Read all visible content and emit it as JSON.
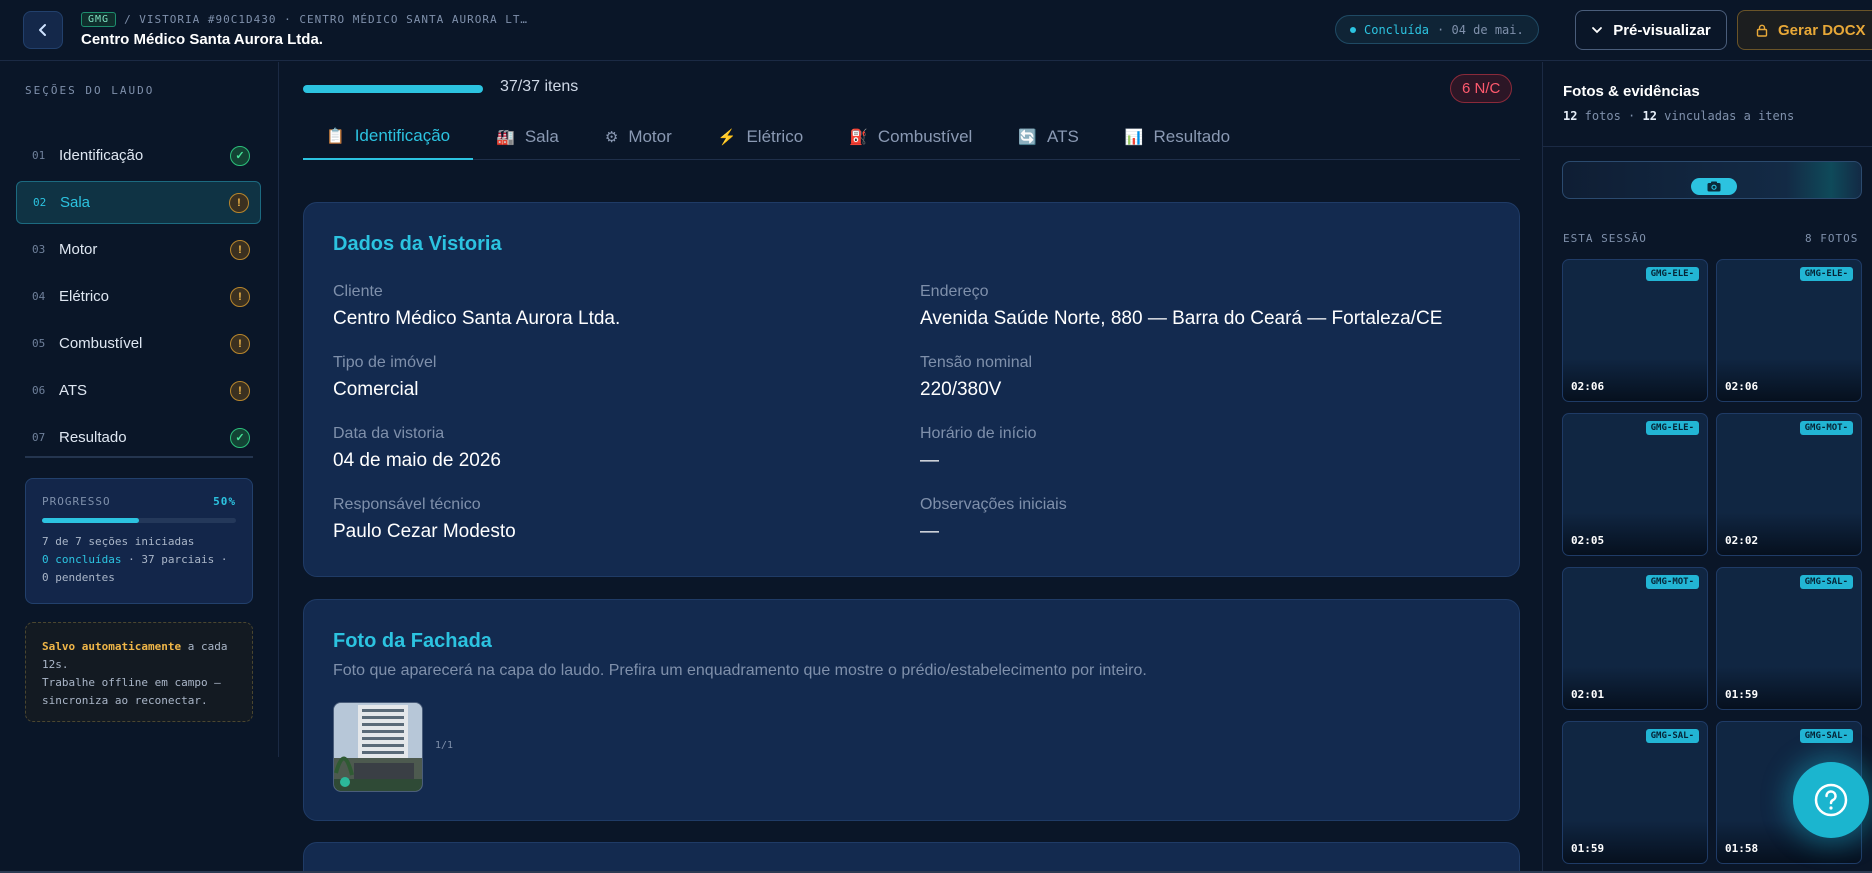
{
  "header": {
    "tag": "GMG",
    "breadcrumb": "/ VISTORIA #90C1D430 · CENTRO MÉDICO SANTA AURORA LT…",
    "title": "Centro Médico Santa Aurora Ltda.",
    "status_label": "Concluída",
    "status_date": "· 04 de mai.",
    "preview_label": "Pré-visualizar",
    "docx_label": "Gerar DOCX"
  },
  "sidebar": {
    "title": "SEÇÕES DO LAUDO",
    "items": [
      {
        "num": "01",
        "label": "Identificação",
        "status": "ok"
      },
      {
        "num": "02",
        "label": "Sala",
        "status": "warn"
      },
      {
        "num": "03",
        "label": "Motor",
        "status": "warn"
      },
      {
        "num": "04",
        "label": "Elétrico",
        "status": "warn"
      },
      {
        "num": "05",
        "label": "Combustível",
        "status": "warn"
      },
      {
        "num": "06",
        "label": "ATS",
        "status": "warn"
      },
      {
        "num": "07",
        "label": "Resultado",
        "status": "ok"
      }
    ],
    "progress": {
      "label": "PROGRESSO",
      "percent": "50%",
      "fill_fraction": 0.5,
      "line1": "7 de 7 seções iniciadas",
      "concluidas": "0 concluídas",
      "parciais": " · 37 parciais ·",
      "line3": "0 pendentes"
    },
    "autosave": {
      "highlight": "Salvo automaticamente",
      "text1": " a cada 12s.",
      "text2": "Trabalhe offline em campo — sincroniza ao reconectar."
    }
  },
  "main": {
    "progress_text": "37/37 itens",
    "progress_fraction": 1.0,
    "nc_badge": "6 N/C",
    "tabs": [
      {
        "icon": "📋",
        "icon_name": "clipboard-icon",
        "label": "Identificação"
      },
      {
        "icon": "🏭",
        "icon_name": "factory-icon",
        "label": "Sala"
      },
      {
        "icon": "⚙",
        "icon_name": "gear-icon",
        "label": "Motor"
      },
      {
        "icon": "⚡",
        "icon_name": "lightning-icon",
        "label": "Elétrico"
      },
      {
        "icon": "⛽",
        "icon_name": "fuel-pump-icon",
        "label": "Combustível"
      },
      {
        "icon": "🔄",
        "icon_name": "refresh-icon",
        "label": "ATS"
      },
      {
        "icon": "📊",
        "icon_name": "chart-icon",
        "label": "Resultado"
      }
    ],
    "dados": {
      "title": "Dados da Vistoria",
      "fields": [
        {
          "label": "Cliente",
          "value": "Centro Médico Santa Aurora Ltda."
        },
        {
          "label": "Endereço",
          "value": "Avenida Saúde Norte, 880 — Barra do Ceará — Fortaleza/CE"
        },
        {
          "label": "Tipo de imóvel",
          "value": "Comercial"
        },
        {
          "label": "Tensão nominal",
          "value": "220/380V"
        },
        {
          "label": "Data da vistoria",
          "value": "04 de maio de 2026"
        },
        {
          "label": "Horário de início",
          "value": "—"
        },
        {
          "label": "Responsável técnico",
          "value": "Paulo Cezar Modesto"
        },
        {
          "label": "Observações iniciais",
          "value": "—"
        }
      ]
    },
    "fachada": {
      "title": "Foto da Fachada",
      "description": "Foto que aparecerá na capa do laudo. Prefira um enquadramento que mostre o prédio/estabelecimento por inteiro.",
      "count": "1/1"
    }
  },
  "right_panel": {
    "title": "Fotos & evidências",
    "photos_count": "12",
    "photos_word": " fotos · ",
    "linked_count": "12",
    "linked_word": " vinculadas a itens",
    "section_label": "ESTA SESSÃO",
    "section_count": "8 FOTOS",
    "photos": [
      {
        "tag": "GMG-ELE-",
        "time": "02:06"
      },
      {
        "tag": "GMG-ELE-",
        "time": "02:06"
      },
      {
        "tag": "GMG-ELE-",
        "time": "02:05"
      },
      {
        "tag": "GMG-MOT-",
        "time": "02:02"
      },
      {
        "tag": "GMG-MOT-",
        "time": "02:01"
      },
      {
        "tag": "GMG-SAL-",
        "time": "01:59"
      },
      {
        "tag": "GMG-SAL-",
        "time": "01:59"
      },
      {
        "tag": "GMG-SAL-",
        "time": "01:58"
      }
    ]
  },
  "colors": {
    "accent": "#2cc3e0",
    "warning": "#f0b648",
    "success": "#47e39a",
    "danger": "#ff5a6e",
    "background": "#0a1628",
    "card": "#132a4f"
  }
}
